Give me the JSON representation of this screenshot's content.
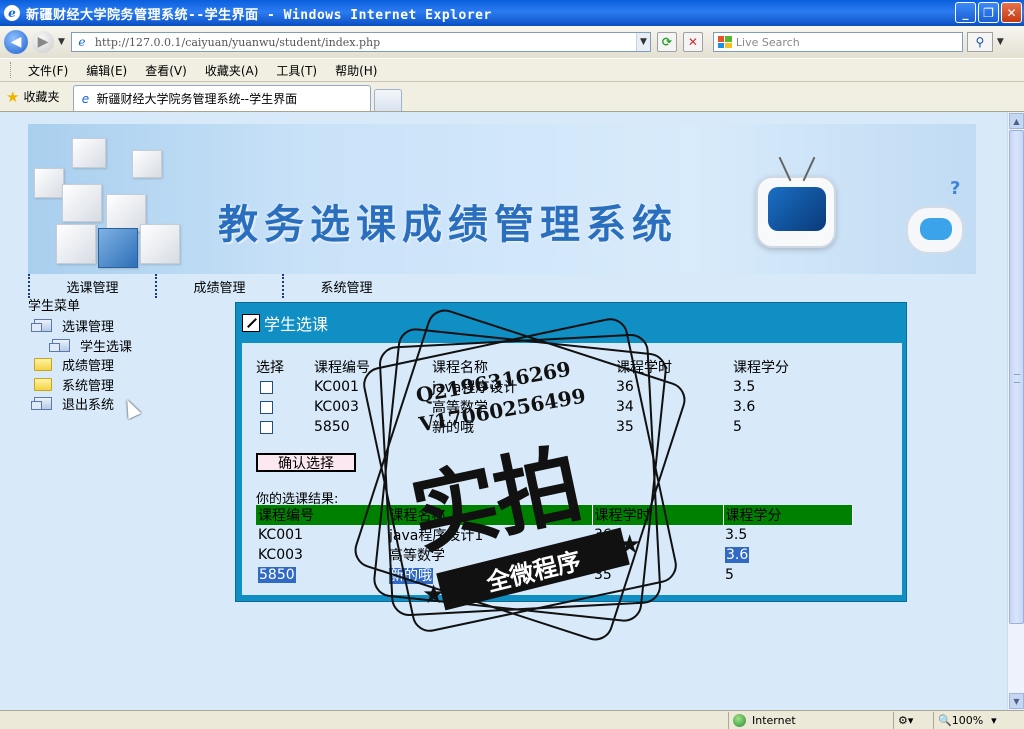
{
  "window": {
    "title": "新疆财经大学院务管理系统--学生界面 - Windows Internet Explorer",
    "controls": [
      "_",
      "❐",
      "✕"
    ]
  },
  "address_bar": {
    "url": "http://127.0.0.1/caiyuan/yuanwu/student/index.php",
    "search_placeholder": "Live Search"
  },
  "menu": [
    "文件(F)",
    "编辑(E)",
    "查看(V)",
    "收藏夹(A)",
    "工具(T)",
    "帮助(H)"
  ],
  "tabs": {
    "favorites_label": "收藏夹",
    "active_tab": "新疆财经大学院务管理系统--学生界面"
  },
  "banner": {
    "title": "教务选课成绩管理系统"
  },
  "top_nav": [
    "选课管理",
    "成绩管理",
    "系统管理"
  ],
  "sidebar": {
    "title": "学生菜单",
    "items": [
      {
        "label": "选课管理",
        "icon": "open-folder-icon",
        "indent": false
      },
      {
        "label": "学生选课",
        "icon": "page-icon",
        "indent": true
      },
      {
        "label": "成绩管理",
        "icon": "folder-icon",
        "indent": false
      },
      {
        "label": "系统管理",
        "icon": "folder-icon",
        "indent": false
      },
      {
        "label": "退出系统",
        "icon": "open-folder-icon",
        "indent": false
      }
    ]
  },
  "panel": {
    "title": "学生选课",
    "columns": [
      "选择",
      "课程编号",
      "课程名称",
      "课程学时",
      "课程学分"
    ],
    "courses": [
      {
        "id": "KC001",
        "name": "java程序设计",
        "hours": "36",
        "credits": "3.5"
      },
      {
        "id": "KC003",
        "name": "高等数学",
        "hours": "34",
        "credits": "3.6"
      },
      {
        "id": "5850",
        "name": "新的哦",
        "hours": "35",
        "credits": "5"
      }
    ],
    "confirm_label": "确认选择",
    "result_label": "你的选课结果:",
    "result_columns": [
      "课程编号",
      "课程名称",
      "课程学时",
      "课程学分"
    ],
    "results": [
      {
        "id": "KC001",
        "name": "java程序设计1",
        "hours": "36",
        "credits": "3.5"
      },
      {
        "id": "KC003",
        "name": "高等数学",
        "hours": "34",
        "credits": "3.6"
      },
      {
        "id": "5850",
        "name": "新的哦",
        "hours": "35",
        "credits": "5"
      }
    ]
  },
  "watermark": {
    "qq": "Q2196316269",
    "vx": "V17060256499",
    "big": "实拍",
    "ribbon": "全微程序"
  },
  "status": {
    "zone": "Internet",
    "zoom": "100%"
  },
  "colors": {
    "titlebar": "#0a5fdc",
    "panel": "#0f8fc4",
    "table_header": "#008000",
    "selection": "#316ac5",
    "page_bg": "#d8eafa"
  }
}
